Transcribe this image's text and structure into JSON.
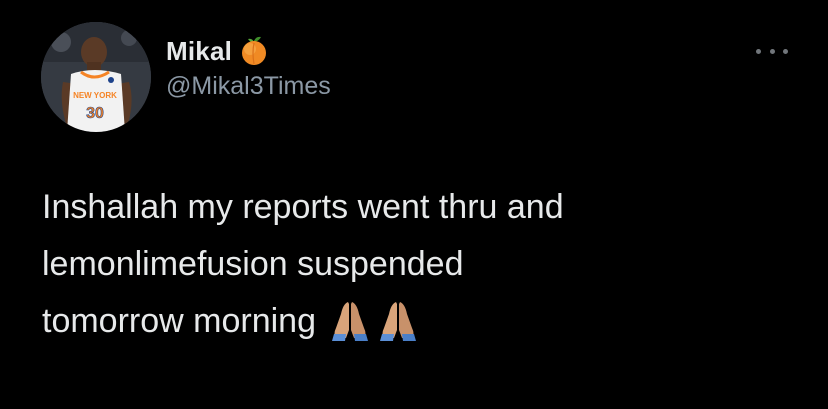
{
  "tweet": {
    "author": {
      "display_name": "Mikal",
      "name_emoji_icon": "peach-emoji-icon",
      "handle": "@Mikal3Times",
      "avatar_jersey_text": "NEW YORK",
      "avatar_jersey_number": "30"
    },
    "text_lines": [
      "Inshallah my reports went thru and",
      "lemonlimefusion suspended",
      "tomorrow morning"
    ],
    "emoji": [
      "folded-hands-emoji-icon",
      "folded-hands-emoji-icon"
    ],
    "more_icon": "more-horizontal-icon"
  },
  "colors": {
    "background": "#000000",
    "text_primary": "#e7e9ea",
    "text_secondary": "#8b98a5",
    "icon_muted": "#71767b"
  }
}
